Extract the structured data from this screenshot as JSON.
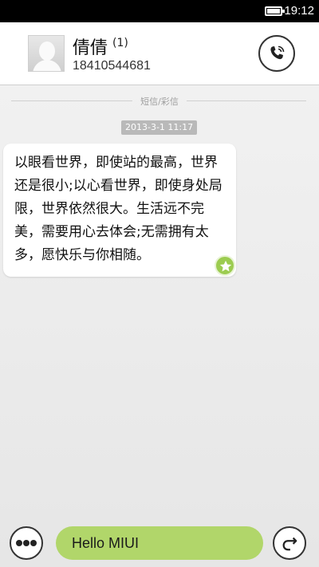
{
  "status_bar": {
    "time": "19:12",
    "battery_icon": "battery-full-icon"
  },
  "header": {
    "contact_name": "倩倩",
    "message_count": "(1)",
    "phone_number": "18410544681",
    "avatar_icon": "default-avatar-icon",
    "call_icon": "phone-call-icon"
  },
  "conversation": {
    "divider_label": "短信/彩信",
    "timestamp": "2013-3-1 11:17",
    "messages": [
      {
        "direction": "incoming",
        "text": "以眼看世界，即使站的最高，世界还是很小;以心看世界，即使身处局限，世界依然很大。生活远不完美，需要用心去体会;无需拥有太多，愿快乐与你相随。",
        "starred": true
      }
    ]
  },
  "composer": {
    "input_value": "Hello MIUI",
    "more_icon": "more-options-icon",
    "send_icon": "send-icon",
    "input_color": "#b1d66a"
  },
  "colors": {
    "accent_green": "#9ccc50",
    "input_green": "#b1d66a",
    "status_bar": "#000000"
  }
}
